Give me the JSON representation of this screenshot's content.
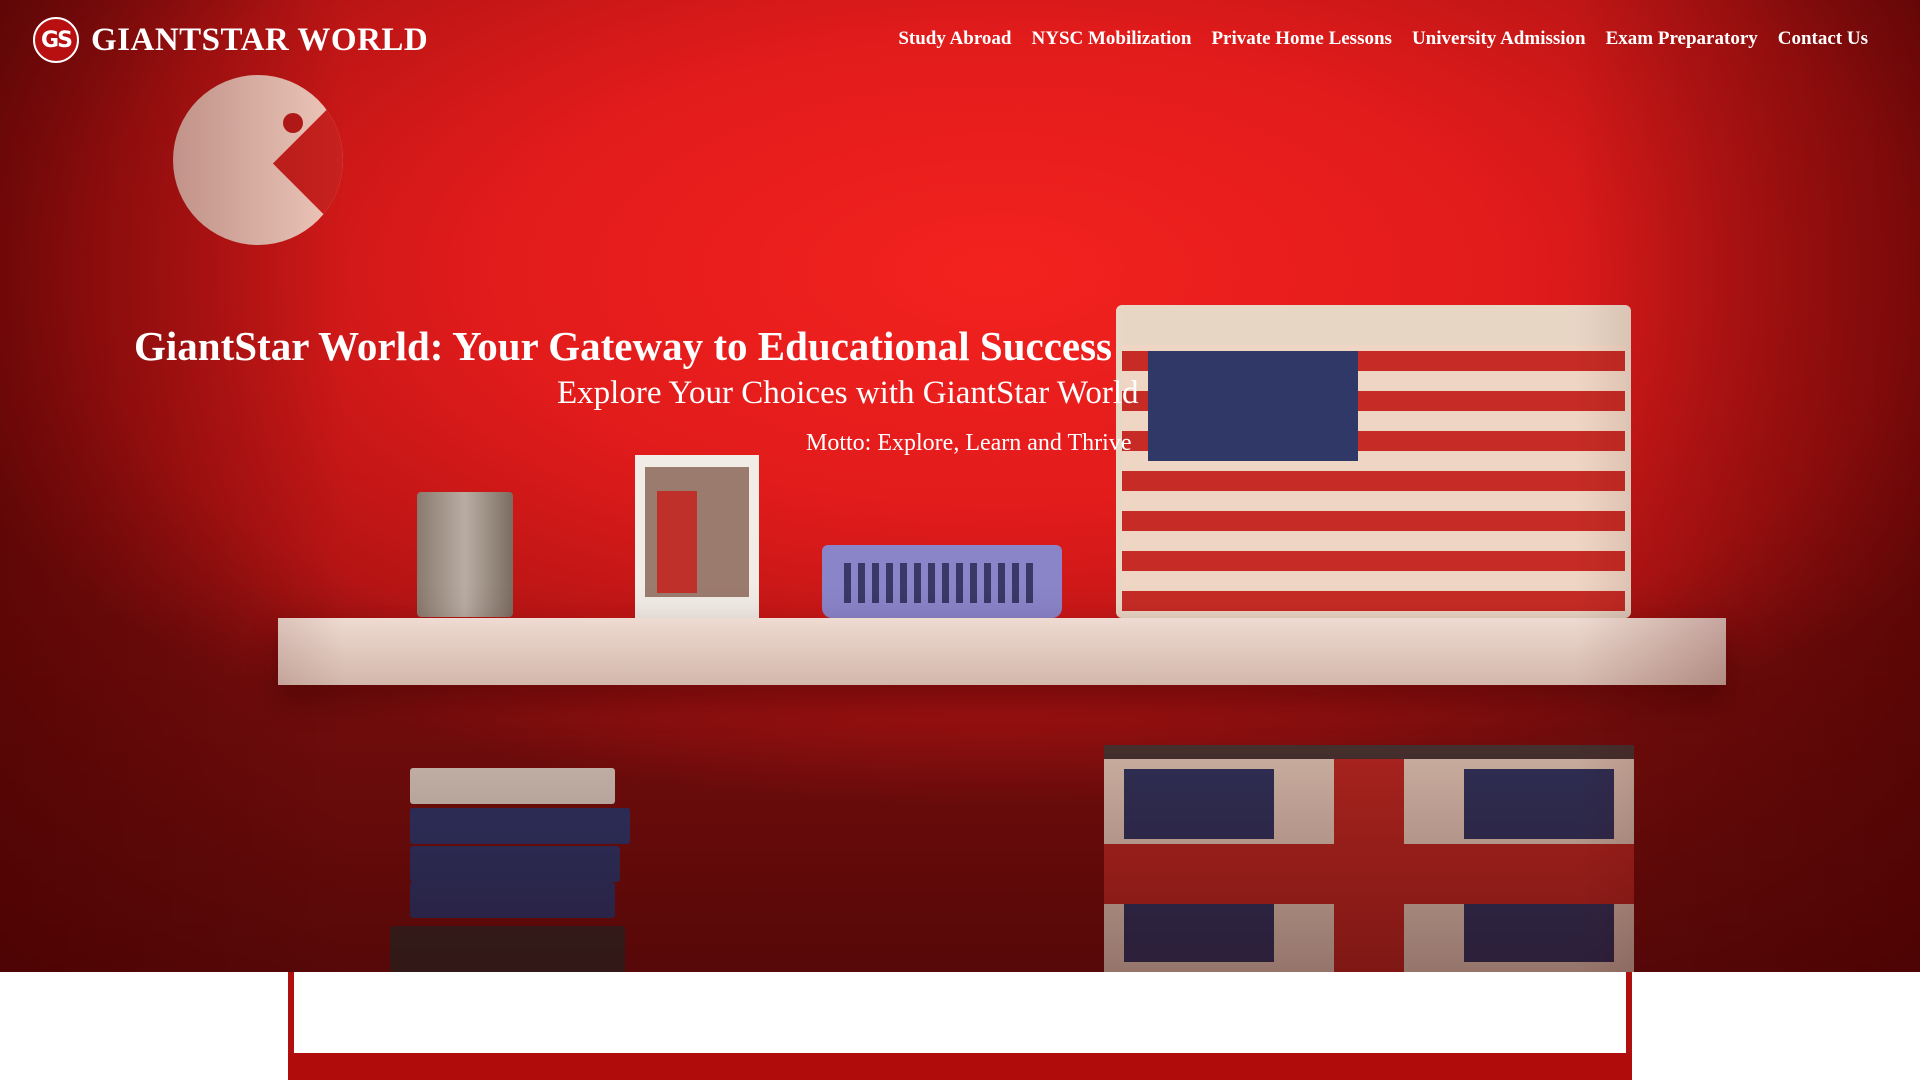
{
  "brand": {
    "logo_mark": "GS",
    "name": "GIANTSTAR WORLD"
  },
  "nav": {
    "items": [
      {
        "label": "Study Abroad"
      },
      {
        "label": "NYSC Mobilization"
      },
      {
        "label": "Private Home Lessons"
      },
      {
        "label": "University Admission"
      },
      {
        "label": "Exam Preparatory"
      },
      {
        "label": "Contact Us"
      }
    ]
  },
  "hero": {
    "title": "GiantStar World: Your Gateway to Educational Success",
    "subtitle": "Explore Your Choices with GiantStar World",
    "motto": "Motto: Explore, Learn and Thrive"
  },
  "colors": {
    "accent": "#b00c0c",
    "hero_red": "#e11b1b",
    "text": "#ffffff"
  }
}
